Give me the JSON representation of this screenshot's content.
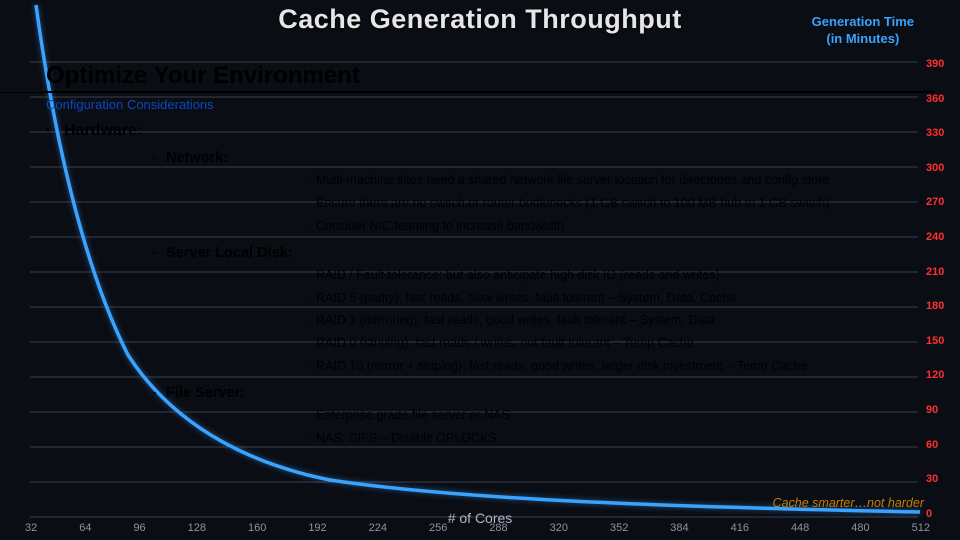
{
  "bg_chart": {
    "title": "Cache Generation Throughput",
    "x_axis_label": "# of Cores",
    "y_axis_label_line1": "Generation Time",
    "y_axis_label_line2": "(in Minutes)",
    "x_ticks": [
      "32",
      "64",
      "96",
      "128",
      "160",
      "192",
      "224",
      "256",
      "288",
      "320",
      "352",
      "384",
      "416",
      "448",
      "480",
      "512"
    ],
    "y_ticks": [
      "390",
      "360",
      "330",
      "300",
      "270",
      "240",
      "210",
      "180",
      "150",
      "120",
      "90",
      "60",
      "30",
      "0"
    ]
  },
  "slide": {
    "title": "Optimize Your Environment",
    "subtitle": "Configuration Considerations",
    "footer": "Cache smarter…not harder"
  },
  "hardware_label": "Hardware:",
  "sections": [
    {
      "label": "Network:",
      "items": [
        "Multi-machine sites need a shared network file server location for directories and config store",
        "Ensure there are no switch or router bottlenecks (1 GB switch to 100 MB hub to 1 GB switch)",
        "Consider NIC teaming to increase bandwidth"
      ]
    },
    {
      "label": "Server Local Disk:",
      "items": [
        "RAID / Fault tolerance; but also anticipate high disk IO (reads and writes)",
        "RAID 5 (parity): fast reads, slow writes, fault tolerant – System, Data, Cache",
        "RAID 1 (mirroring): fast reads, good writes, fault tolerant – System, Data",
        "RAID 0 (striping): fast reads / writes, not fault tolerant – Temp Cache",
        "RAID 10 (mirror + striping): fast reads, good writes, larger disk investment – Temp Cache"
      ]
    },
    {
      "label": "File Server:",
      "items": [
        "Enterprise grade file server or NAS",
        "NAS: CIFS – Disable OPLOCKS"
      ]
    }
  ],
  "chart_data": {
    "type": "line",
    "title": "Cache Generation Throughput",
    "xlabel": "# of Cores",
    "ylabel": "Generation Time (in Minutes)",
    "xlim": [
      32,
      512
    ],
    "ylim": [
      0,
      390
    ],
    "series": [
      {
        "name": "Generation Time",
        "x": [
          32,
          64,
          96,
          128,
          160,
          192,
          224,
          256,
          288,
          320,
          352,
          384,
          416,
          448,
          480,
          512
        ],
        "values": [
          390,
          210,
          140,
          105,
          85,
          70,
          60,
          52,
          46,
          42,
          38,
          34,
          31,
          29,
          27,
          25
        ]
      }
    ]
  }
}
